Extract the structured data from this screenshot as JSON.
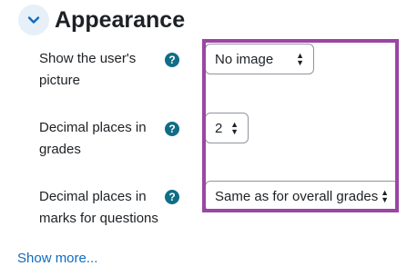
{
  "section": {
    "title": "Appearance",
    "toggle_icon": "chevron-down-icon"
  },
  "rows": [
    {
      "label_lines": [
        "Show the user's",
        "picture"
      ],
      "help_glyph": "?",
      "select_value": "No image"
    },
    {
      "label_lines": [
        "Decimal places in",
        "grades"
      ],
      "help_glyph": "?",
      "select_value": "2"
    },
    {
      "label_lines": [
        "Decimal places in",
        "marks for questions"
      ],
      "help_glyph": "?",
      "select_value": "Same as for overall grades"
    }
  ],
  "show_more_label": "Show more...",
  "colors": {
    "highlight": "#9a46a3",
    "help_icon": "#0f6e85",
    "link": "#0f6cbf",
    "toggle_bg": "#e7f0f8"
  }
}
